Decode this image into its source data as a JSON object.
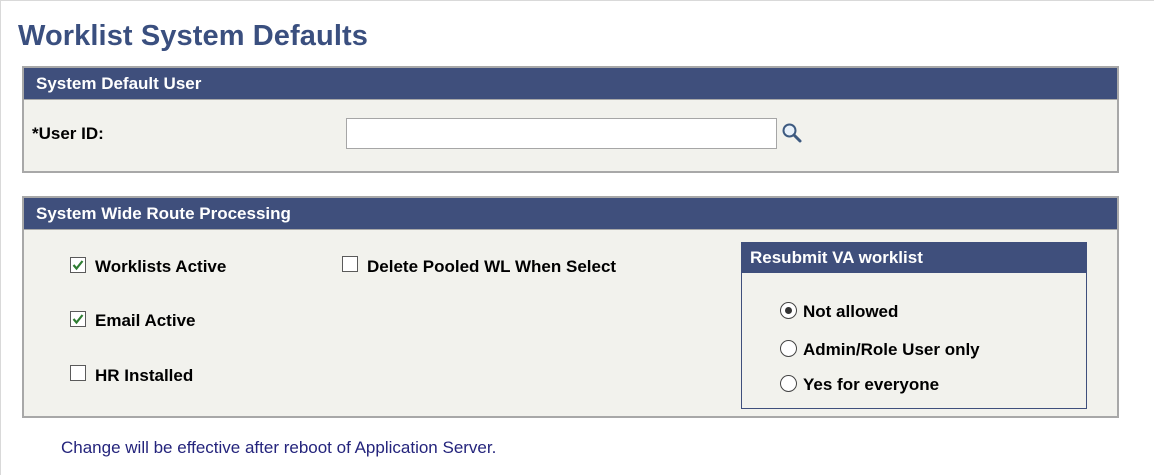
{
  "page": {
    "title": "Worklist System Defaults"
  },
  "system_default_user": {
    "header": "System Default User",
    "user_id_label": "*User ID:",
    "user_id_value": "",
    "lookup_icon": "magnifier-icon"
  },
  "route_processing": {
    "header": "System Wide Route Processing",
    "checkboxes": [
      {
        "label": "Worklists Active",
        "checked": true
      },
      {
        "label": "Email Active",
        "checked": true
      },
      {
        "label": "HR Installed",
        "checked": false
      },
      {
        "label": "Delete Pooled WL When Select",
        "checked": false
      }
    ],
    "resubmit": {
      "header": "Resubmit VA worklist",
      "options": [
        {
          "label": "Not allowed",
          "selected": true
        },
        {
          "label": "Admin/Role User only",
          "selected": false
        },
        {
          "label": "Yes for everyone",
          "selected": false
        }
      ]
    }
  },
  "footer": {
    "note": "Change will be effective after reboot of Application Server."
  },
  "colors": {
    "header_bg": "#3f4f7c",
    "group_bg": "#f2f2ed",
    "title_color": "#3a4f7f",
    "note_color": "#24247c",
    "check_color": "#2e7d32"
  }
}
